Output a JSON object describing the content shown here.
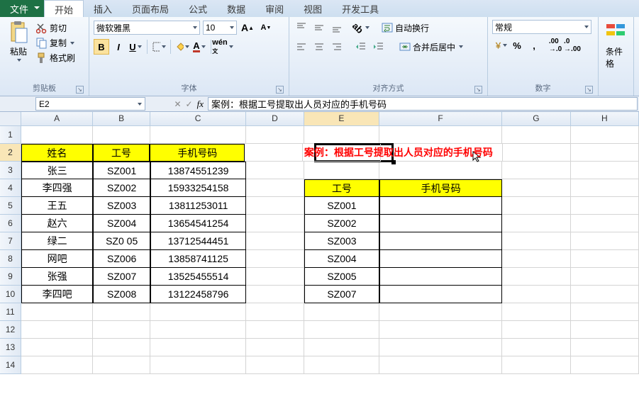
{
  "tabs": {
    "file": "文件",
    "active": "开始",
    "others": [
      "插入",
      "页面布局",
      "公式",
      "数据",
      "审阅",
      "视图",
      "开发工具"
    ]
  },
  "ribbon": {
    "clipboard": {
      "label": "剪贴板",
      "paste": "粘贴",
      "cut": "剪切",
      "copy": "复制",
      "painter": "格式刷"
    },
    "font": {
      "label": "字体",
      "name": "微软雅黑",
      "size": "10",
      "bold": "B",
      "italic": "I",
      "underline": "U"
    },
    "align": {
      "label": "对齐方式",
      "wrap": "自动换行",
      "merge": "合并后居中"
    },
    "number": {
      "label": "数字",
      "format": "常规"
    },
    "cond": "条件格"
  },
  "namebox": "E2",
  "formula": "案例：根据工号提取出人员对应的手机号码",
  "cols": [
    "A",
    "B",
    "C",
    "D",
    "E",
    "F",
    "G",
    "H"
  ],
  "rows": [
    "1",
    "2",
    "3",
    "4",
    "5",
    "6",
    "7",
    "8",
    "9",
    "10",
    "11",
    "12",
    "13",
    "14"
  ],
  "table1": {
    "headers": [
      "姓名",
      "工号",
      "手机号码"
    ],
    "rows": [
      [
        "张三",
        "SZ001",
        "13874551239"
      ],
      [
        "李四强",
        "SZ002",
        "15933254158"
      ],
      [
        "王五",
        "SZ003",
        "13811253011"
      ],
      [
        "赵六",
        "SZ004",
        "13654541254"
      ],
      [
        "绿二",
        "SZ0 05",
        "13712544451"
      ],
      [
        "网吧",
        "SZ006",
        "13858741125"
      ],
      [
        "张强",
        "SZ007",
        "13525455514"
      ],
      [
        "李四吧",
        "SZ008",
        "13122458796"
      ]
    ]
  },
  "case_text": "案例：根据工号提取出人员对应的手机号码",
  "table2": {
    "headers": [
      "工号",
      "手机号码"
    ],
    "ids": [
      "SZ001",
      "SZ002",
      "SZ003",
      "SZ004",
      "SZ005",
      "SZ007"
    ]
  }
}
